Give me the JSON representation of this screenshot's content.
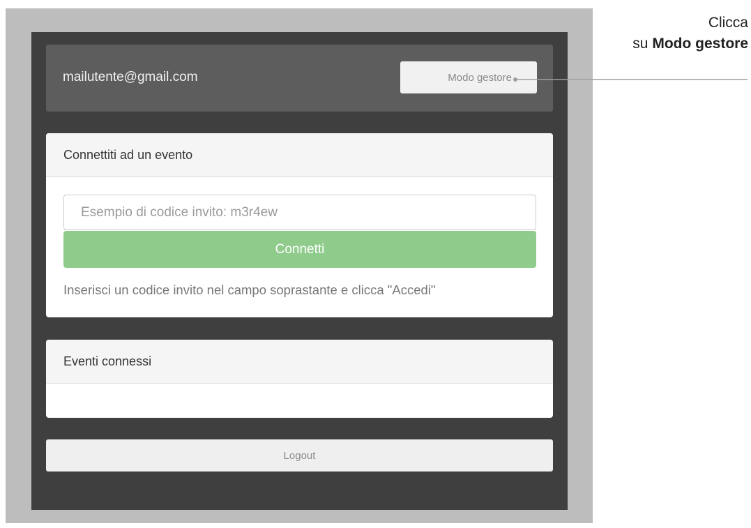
{
  "header": {
    "email": "mailutente@gmail.com",
    "manager_mode_label": "Modo gestore"
  },
  "connect_panel": {
    "title": "Connettiti ad un evento",
    "input_placeholder": "Esempio di codice invito: m3r4ew",
    "input_value": "",
    "connect_label": "Connetti",
    "help_text": "Inserisci un codice invito nel campo soprastante e clicca \"Accedi\""
  },
  "events_panel": {
    "title": "Eventi connessi",
    "items": []
  },
  "logout_label": "Logout",
  "annotation": {
    "line1": "Clicca",
    "line2_prefix": "su",
    "line2_bold": "Modo gestore"
  },
  "colors": {
    "frame_gray": "#bdbdbd",
    "app_background": "#3f3f3f",
    "user_bar": "#5d5d5d",
    "connect_green": "#8fcc8c",
    "callout_line": "#9e9e9e"
  }
}
